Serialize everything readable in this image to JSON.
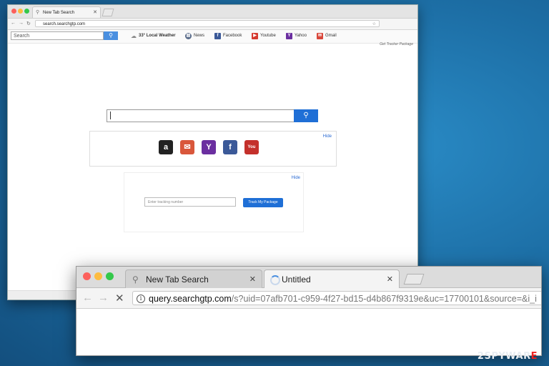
{
  "back_window": {
    "tab_title": "New Tab Search",
    "url": "search.searchgtp.com",
    "toolbar": {
      "search_placeholder": "Search",
      "weather": "33° Local Weather",
      "bookmarks": [
        {
          "label": "News",
          "icon": "news-icon",
          "color": "#5a6c8a"
        },
        {
          "label": "Facebook",
          "icon": "facebook-icon",
          "color": "#3b5998"
        },
        {
          "label": "Youtube",
          "icon": "youtube-icon",
          "color": "#d63a2f"
        },
        {
          "label": "Yahoo",
          "icon": "yahoo-icon",
          "color": "#6b2fa0"
        },
        {
          "label": "Gmail",
          "icon": "gmail-icon",
          "color": "#d9473b"
        }
      ]
    },
    "package_link": "Get Tracker Package",
    "shortcuts": {
      "hide_label": "Hide",
      "items": [
        {
          "name": "amazon-shortcut",
          "icon": "amazon-icon",
          "glyph": "a",
          "color": "#222222"
        },
        {
          "name": "gmail-shortcut",
          "icon": "mail-icon",
          "glyph": "✉",
          "color": "#d9573b"
        },
        {
          "name": "yahoo-shortcut",
          "icon": "yahoo-icon",
          "glyph": "Y",
          "color": "#6b2fa0"
        },
        {
          "name": "facebook-shortcut",
          "icon": "facebook-icon",
          "glyph": "f",
          "color": "#3b5998"
        },
        {
          "name": "youtube-shortcut",
          "icon": "youtube-icon",
          "glyph": "You",
          "color": "#c4302b"
        }
      ]
    },
    "tracking": {
      "hide_label": "Hide",
      "placeholder": "Enter tracking number",
      "button_label": "Track My Package"
    }
  },
  "front_window": {
    "tabs": [
      {
        "title": "New Tab Search",
        "active": false
      },
      {
        "title": "Untitled",
        "active": true,
        "loading": true
      }
    ],
    "url_host": "query.searchgtp.com",
    "url_rest": "/s?uid=07afb701-c959-4f27-bd15-d4b867f9319e&uc=17700101&source=&i_i"
  },
  "watermark": {
    "prefix": "2SPYWAR",
    "suffix": "E"
  },
  "colors": {
    "accent": "#1f6fd6",
    "desktop": "#1d6fa6",
    "close": "#fc605c",
    "minimize": "#fdbc40",
    "zoom": "#34c84a"
  }
}
